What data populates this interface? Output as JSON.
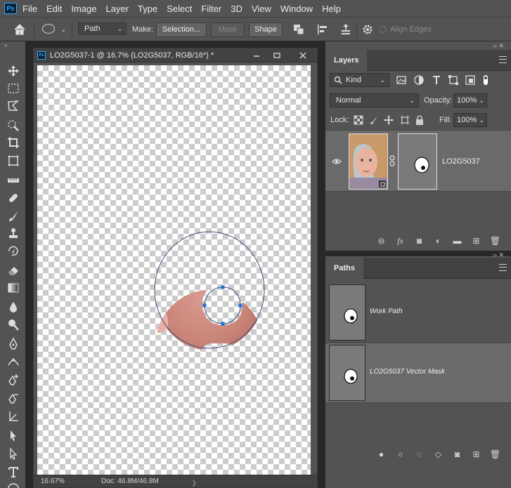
{
  "app": {
    "logo": "Ps"
  },
  "menu": [
    "File",
    "Edit",
    "Image",
    "Layer",
    "Type",
    "Select",
    "Filter",
    "3D",
    "View",
    "Window",
    "Help"
  ],
  "options": {
    "mode": "Path",
    "make_label": "Make:",
    "selection_label": "Selection...",
    "mask_label": "Mask",
    "shape_label": "Shape",
    "align_edges_label": "Align Edges"
  },
  "document": {
    "title": "LO2G5037-1 @ 16.7% (LO2G5037, RGB/16*) *",
    "zoom": "16.67%",
    "doc_size": "Doc: 46.8M/46.8M"
  },
  "layers_panel": {
    "tab": "Layers",
    "kind": "Kind",
    "blend_mode": "Normal",
    "opacity_label": "Opacity:",
    "opacity": "100%",
    "lock_label": "Lock:",
    "fill_label": "Fill:",
    "fill": "100%",
    "layers": [
      {
        "name": "LO2G5037"
      }
    ]
  },
  "paths_panel": {
    "tab": "Paths",
    "paths": [
      {
        "name": "Work Path"
      },
      {
        "name": "LO2G5037 Vector Mask"
      }
    ]
  },
  "colors": {
    "panel": "#535353",
    "dark": "#282828",
    "selected_row": "#6a6a6a",
    "anchor_point": "#1f6fe0",
    "ps_blue": "#31a8ff"
  }
}
